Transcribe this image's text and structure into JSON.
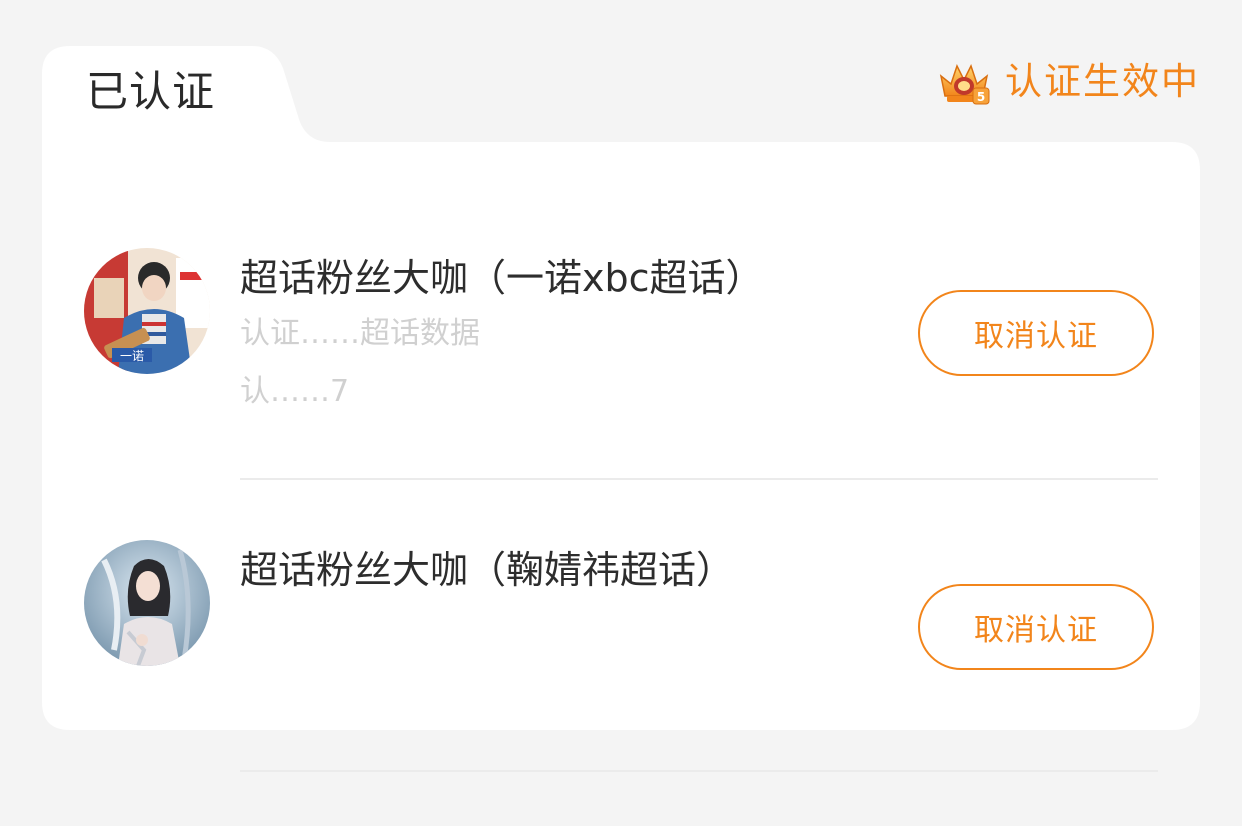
{
  "header": {
    "tab_title": "已认证",
    "status_text": "认证生效中",
    "status_icon": "crown-badge-icon"
  },
  "colors": {
    "accent": "#f2851b",
    "page_bg": "#f4f4f4",
    "card_bg": "#ffffff",
    "title_text": "#2d2d2d"
  },
  "items": [
    {
      "title": "超话粉丝大咖（一诺xbc超话）",
      "sub_line_1": "认证……超话数据",
      "sub_line_2": "认……7",
      "button_label": "取消认证",
      "avatar": "avatar-photo"
    },
    {
      "title": "超话粉丝大咖（鞠婧祎超话）",
      "button_label": "取消认证",
      "avatar": "avatar-photo"
    }
  ]
}
